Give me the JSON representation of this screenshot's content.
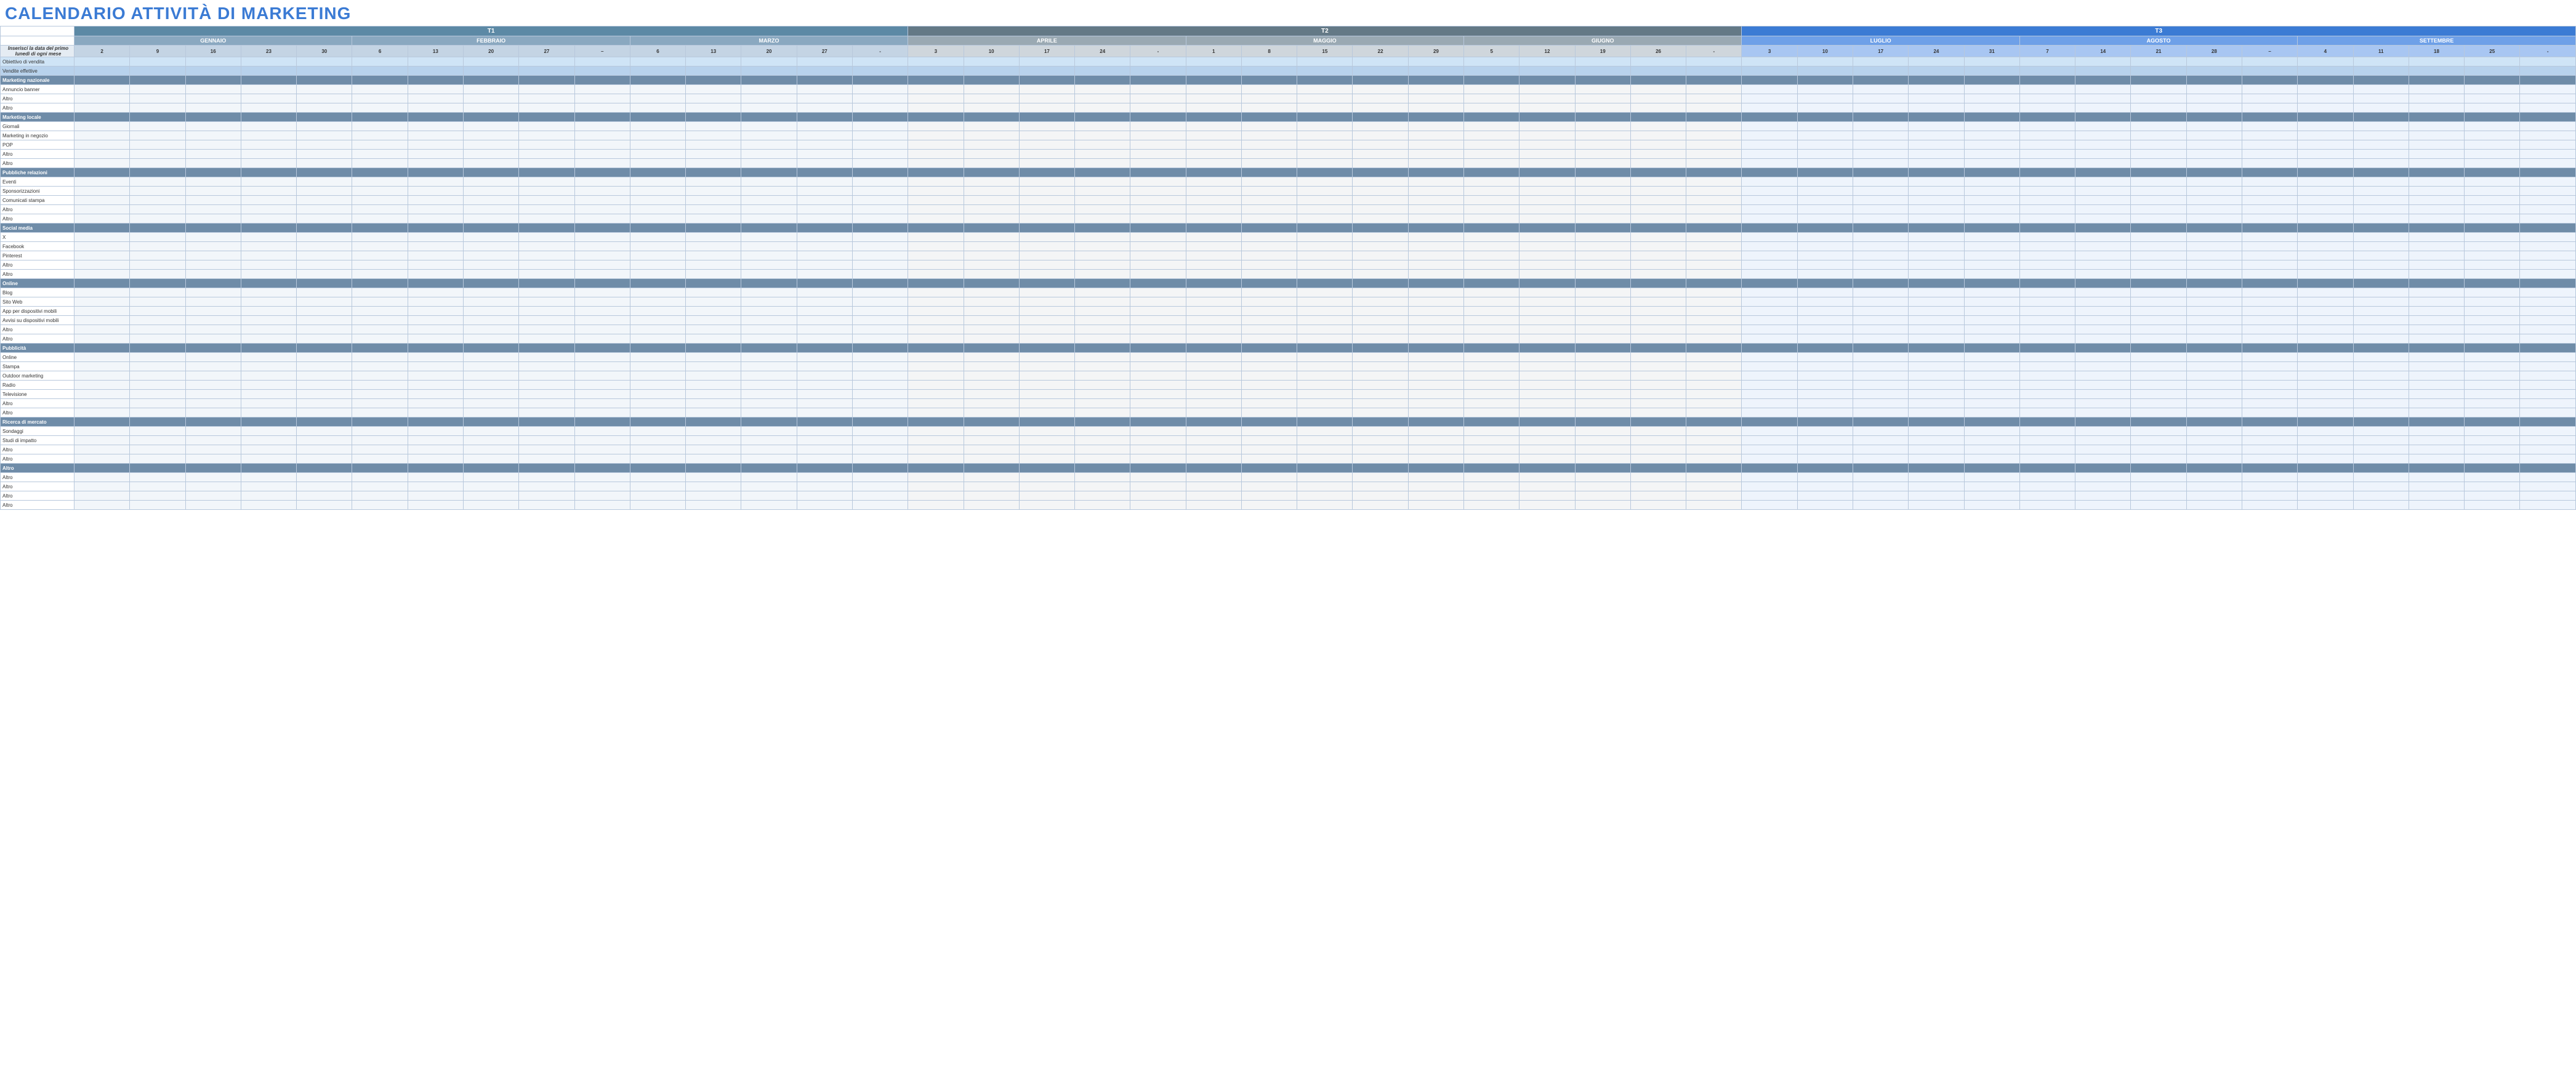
{
  "title": "CALENDARIO ATTIVITÀ DI MARKETING",
  "instruction": "Inserisci la data del primo lunedì di ogni mese",
  "goal_label": "Obiettivo di vendita",
  "effective_label": "Vendite effettive",
  "quarters": [
    "T1",
    "T2",
    "T3"
  ],
  "months": [
    "GENNAIO",
    "FEBBRAIO",
    "MARZO",
    "APRILE",
    "MAGGIO",
    "GIUGNO",
    "LUGLIO",
    "AGOSTO",
    "SETTEMBRE"
  ],
  "weeks": [
    [
      "2",
      "9",
      "16",
      "23",
      "30"
    ],
    [
      "6",
      "13",
      "20",
      "27",
      "–"
    ],
    [
      "6",
      "13",
      "20",
      "27",
      "-"
    ],
    [
      "3",
      "10",
      "17",
      "24",
      "-"
    ],
    [
      "1",
      "8",
      "15",
      "22",
      "29"
    ],
    [
      "5",
      "12",
      "19",
      "26",
      "-"
    ],
    [
      "3",
      "10",
      "17",
      "24",
      "31"
    ],
    [
      "7",
      "14",
      "21",
      "28",
      "–"
    ],
    [
      "4",
      "11",
      "18",
      "25",
      "-"
    ]
  ],
  "sections": [
    {
      "header": "Marketing nazionale",
      "rows": [
        "Annuncio banner",
        "Altro",
        "Altro"
      ]
    },
    {
      "header": "Marketing locale",
      "rows": [
        "Giornali",
        "Marketing in negozio",
        "POP",
        "Altro",
        "Altro"
      ]
    },
    {
      "header": "Pubbliche relazioni",
      "rows": [
        "Eventi",
        "Sponsorizzazioni",
        "Comunicati stampa",
        "Altro",
        "Altro"
      ]
    },
    {
      "header": "Social media",
      "rows": [
        "X",
        "Facebook",
        "Pinterest",
        "Altro",
        "Altro"
      ]
    },
    {
      "header": "Online",
      "rows": [
        "Blog",
        "Sito Web",
        "App per dispositivi mobili",
        "Avvisi su dispositivi mobili",
        "Altro",
        "Altro"
      ]
    },
    {
      "header": "Pubblicità",
      "rows": [
        "Online",
        "Stampa",
        "Outdoor marketing",
        "Radio",
        "Televisione",
        "Altro",
        "Altro"
      ]
    },
    {
      "header": "Ricerca di mercato",
      "rows": [
        "Sondaggi",
        "Studi di impatto",
        "Altro",
        "Altro"
      ]
    },
    {
      "header": "Altro",
      "rows": [
        "Altro",
        "Altro",
        "Altro",
        "Altro"
      ]
    }
  ]
}
